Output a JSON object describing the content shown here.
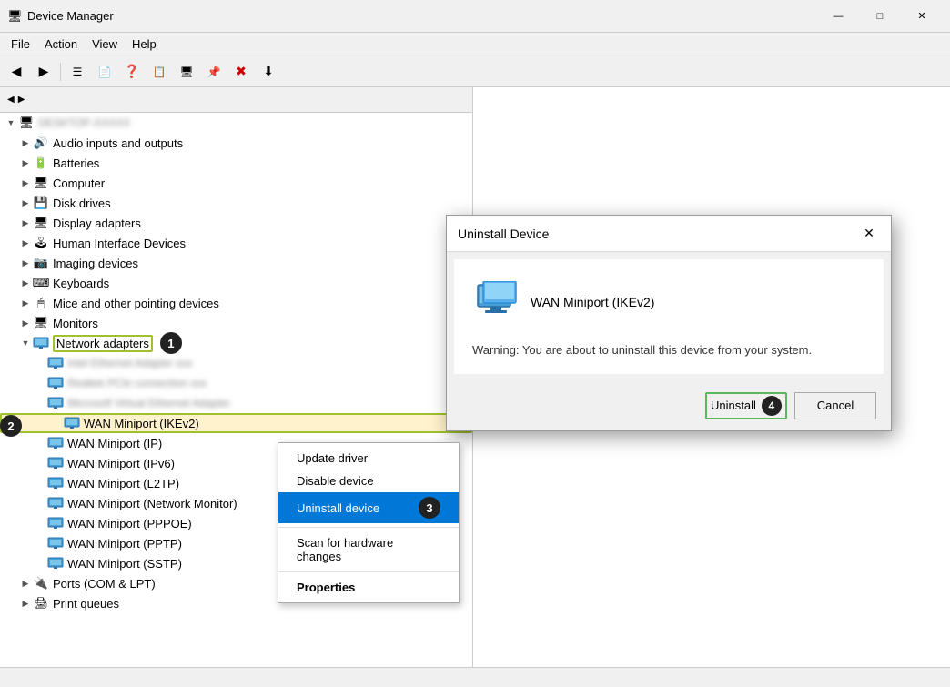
{
  "window": {
    "title": "Device Manager",
    "icon": "🖥"
  },
  "menu": {
    "items": [
      "File",
      "Action",
      "View",
      "Help"
    ]
  },
  "toolbar": {
    "buttons": [
      "◀",
      "▶",
      "☰",
      "📄",
      "❓",
      "📋",
      "🖥",
      "📌",
      "✖",
      "⬇"
    ]
  },
  "tree": {
    "root_label": "DESKTOP-XXXXX",
    "items": [
      {
        "label": "Audio inputs and outputs",
        "icon": "🔊",
        "indent": 1
      },
      {
        "label": "Batteries",
        "icon": "🔋",
        "indent": 1
      },
      {
        "label": "Computer",
        "icon": "🖥",
        "indent": 1
      },
      {
        "label": "Disk drives",
        "icon": "💾",
        "indent": 1
      },
      {
        "label": "Display adapters",
        "icon": "🖥",
        "indent": 1
      },
      {
        "label": "Human Interface Devices",
        "icon": "🕹",
        "indent": 1
      },
      {
        "label": "Imaging devices",
        "icon": "📷",
        "indent": 1
      },
      {
        "label": "Keyboards",
        "icon": "⌨",
        "indent": 1
      },
      {
        "label": "Mice and other pointing devices",
        "icon": "🖱",
        "indent": 1
      },
      {
        "label": "Monitors",
        "icon": "🖥",
        "indent": 1
      },
      {
        "label": "Network adapters",
        "icon": "🌐",
        "indent": 1,
        "expanded": true
      },
      {
        "label": "(blurred adapter 1)",
        "icon": "🖧",
        "indent": 2,
        "blurred": true
      },
      {
        "label": "(blurred adapter 2)",
        "icon": "🖧",
        "indent": 2,
        "blurred": true
      },
      {
        "label": "(blurred adapter 3)",
        "icon": "🖧",
        "indent": 2,
        "blurred": true
      },
      {
        "label": "WAN Miniport (IKEv2)",
        "icon": "🖧",
        "indent": 2,
        "highlighted": true
      },
      {
        "label": "WAN Miniport (IP)",
        "icon": "🖧",
        "indent": 2
      },
      {
        "label": "WAN Miniport (IPv6)",
        "icon": "🖧",
        "indent": 2
      },
      {
        "label": "WAN Miniport (L2TP)",
        "icon": "🖧",
        "indent": 2
      },
      {
        "label": "WAN Miniport (Network Monitor)",
        "icon": "🖧",
        "indent": 2
      },
      {
        "label": "WAN Miniport (PPPOE)",
        "icon": "🖧",
        "indent": 2
      },
      {
        "label": "WAN Miniport (PPTP)",
        "icon": "🖧",
        "indent": 2
      },
      {
        "label": "WAN Miniport (SSTP)",
        "icon": "🖧",
        "indent": 2
      },
      {
        "label": "Ports (COM & LPT)",
        "icon": "🔌",
        "indent": 1
      },
      {
        "label": "Print queues",
        "icon": "🖨",
        "indent": 1
      }
    ]
  },
  "context_menu": {
    "items": [
      {
        "label": "Update driver",
        "active": false
      },
      {
        "label": "Disable device",
        "active": false
      },
      {
        "label": "Uninstall device",
        "active": true
      },
      {
        "label": "Scan for hardware changes",
        "active": false
      },
      {
        "label": "Properties",
        "active": false,
        "bold": true
      }
    ]
  },
  "dialog": {
    "title": "Uninstall Device",
    "device_name": "WAN Miniport (IKEv2)",
    "warning_text": "Warning: You are about to uninstall this device from your system.",
    "btn_uninstall": "Uninstall",
    "btn_cancel": "Cancel"
  },
  "steps": {
    "step1": "1",
    "step2": "2",
    "step3": "3",
    "step4": "4"
  }
}
